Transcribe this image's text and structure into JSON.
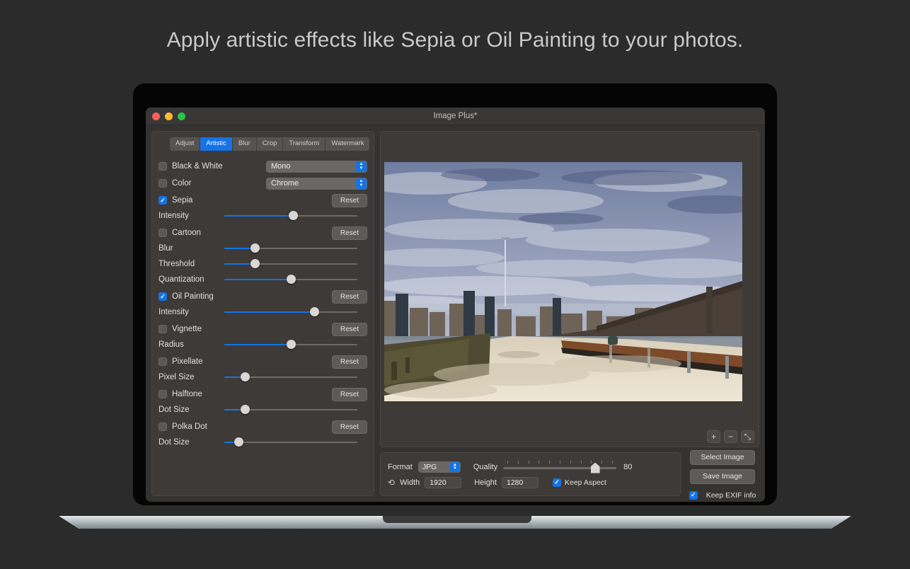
{
  "headline": "Apply artistic effects like Sepia or Oil Painting to your photos.",
  "window": {
    "title": "Image Plus*",
    "traffic_lights": [
      "close-button",
      "minimize-button",
      "maximize-button"
    ]
  },
  "tabs": [
    {
      "label": "Adjust",
      "active": false
    },
    {
      "label": "Artistic",
      "active": true
    },
    {
      "label": "Blur",
      "active": false
    },
    {
      "label": "Crop",
      "active": false
    },
    {
      "label": "Transform",
      "active": false
    },
    {
      "label": "Watermark",
      "active": false
    }
  ],
  "effects": {
    "black_and_white": {
      "label": "Black & White",
      "checked": false,
      "select_value": "Mono"
    },
    "color": {
      "label": "Color",
      "checked": false,
      "select_value": "Chrome"
    },
    "sepia": {
      "label": "Sepia",
      "checked": true,
      "reset_label": "Reset",
      "sliders": [
        {
          "label": "Intensity",
          "percent": 52
        }
      ]
    },
    "cartoon": {
      "label": "Cartoon",
      "checked": false,
      "reset_label": "Reset",
      "sliders": [
        {
          "label": "Blur",
          "percent": 21
        },
        {
          "label": "Threshold",
          "percent": 21
        },
        {
          "label": "Quantization",
          "percent": 50
        }
      ]
    },
    "oil_painting": {
      "label": "Oil Painting",
      "checked": true,
      "reset_label": "Reset",
      "sliders": [
        {
          "label": "Intensity",
          "percent": 69
        }
      ]
    },
    "vignette": {
      "label": "Vignette",
      "checked": false,
      "reset_label": "Reset",
      "sliders": [
        {
          "label": "Radius",
          "percent": 50
        }
      ]
    },
    "pixellate": {
      "label": "Pixellate",
      "checked": false,
      "reset_label": "Reset",
      "sliders": [
        {
          "label": "Pixel Size",
          "percent": 13
        }
      ]
    },
    "halftone": {
      "label": "Halftone",
      "checked": false,
      "reset_label": "Reset",
      "sliders": [
        {
          "label": "Dot Size",
          "percent": 13
        }
      ]
    },
    "polka_dot": {
      "label": "Polka Dot",
      "checked": false,
      "reset_label": "Reset",
      "sliders": [
        {
          "label": "Dot Size",
          "percent": 8
        }
      ]
    }
  },
  "preview": {
    "description": "Brooklyn Bridge waterfront promenade with oil-painting effect applied",
    "zoom_in_label": "+",
    "zoom_out_label": "−",
    "fit_label": "⤡"
  },
  "export": {
    "format_label": "Format",
    "format_value": "JPG",
    "quality_label": "Quality",
    "quality_value": "80",
    "quality_percent": 84,
    "quality_tick_count": 11,
    "width_label": "Width",
    "width_value": "1920",
    "height_label": "Height",
    "height_value": "1280",
    "keep_aspect_label": "Keep Aspect",
    "keep_aspect_checked": true,
    "refresh_icon": "refresh-icon"
  },
  "actions": {
    "select_image_label": "Select Image",
    "save_image_label": "Save Image",
    "keep_exif_label": "Keep EXIF info",
    "keep_exif_checked": true
  },
  "colors": {
    "accent": "#1473e6",
    "panel": "#3d3a37",
    "window": "#353331",
    "page_bg": "#2b2b2b"
  }
}
